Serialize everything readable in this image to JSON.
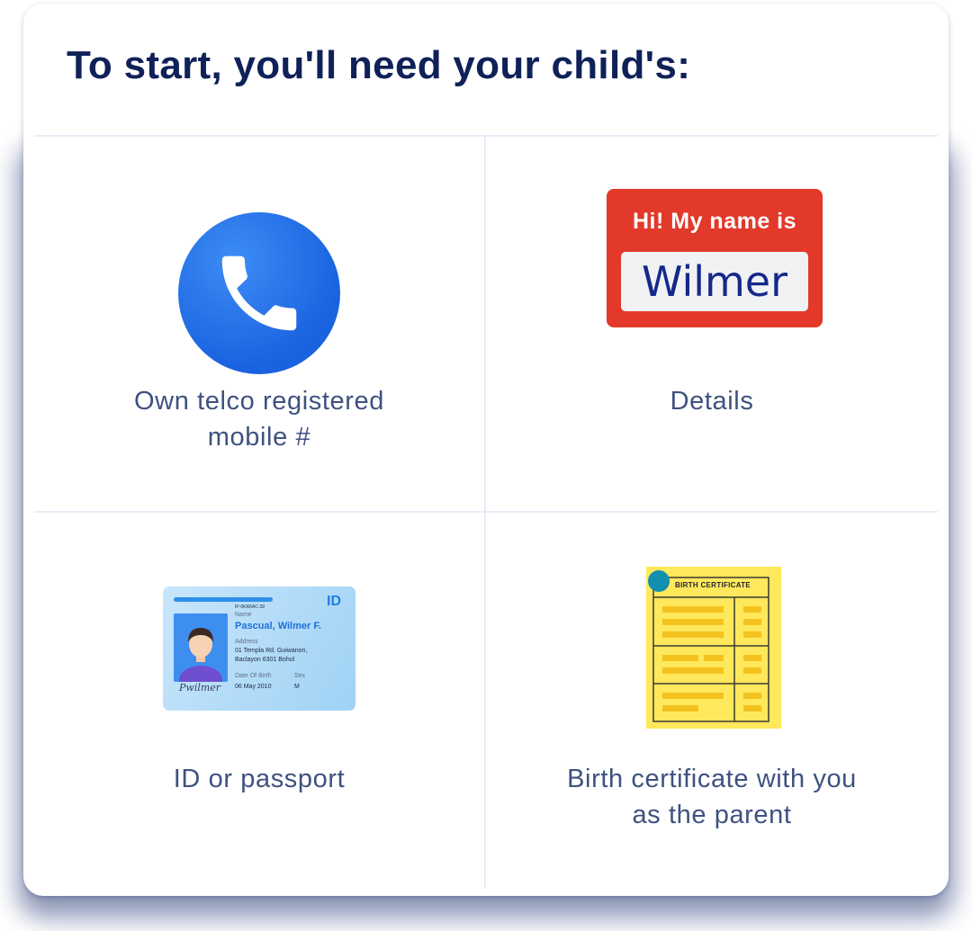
{
  "heading": "To start, you'll need your child's:",
  "items": [
    {
      "label_lines": [
        "Own telco registered",
        "mobile #"
      ],
      "icon": "phone-icon"
    },
    {
      "label_lines": [
        "Details"
      ],
      "icon": "name-tag-icon"
    },
    {
      "label_lines": [
        "ID or passport"
      ],
      "icon": "id-card-icon"
    },
    {
      "label_lines": [
        "Birth certificate with you",
        "as the parent"
      ],
      "icon": "birth-certificate-icon"
    }
  ],
  "name_tag": {
    "greeting": "Hi! My name is",
    "name": "Wilmer"
  },
  "id_card": {
    "tag": "ID",
    "id_number": "IP-0KR6AC-39",
    "name_label": "Name",
    "name": "Pascual, Wilmer F.",
    "address_label": "Address",
    "address_line1": "01 Templa Rd. Guiwanon,",
    "address_line2": "Baclayon 6301 Bohol",
    "dob_label": "Date Of Birth",
    "dob": "06 May 2010",
    "sex_label": "Sex",
    "sex": "M",
    "signature": "Pwilmer"
  },
  "certificate": {
    "title": "BIRTH CERTIFICATE"
  },
  "colors": {
    "heading": "#0f2158",
    "label": "#3e5280",
    "phone_blue": "#1a62e0",
    "tag_red": "#e2392b",
    "cert_yellow": "#ffe85c"
  }
}
